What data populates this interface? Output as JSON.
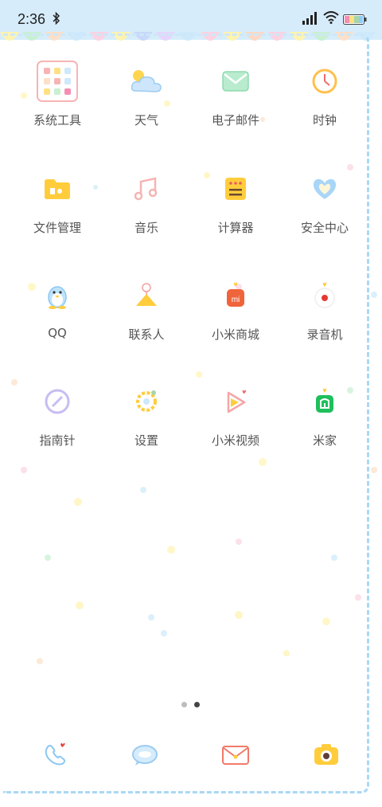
{
  "status": {
    "time": "2:36"
  },
  "apps": [
    {
      "name": "系统工具",
      "icon": "folder-tools-icon"
    },
    {
      "name": "天气",
      "icon": "weather-icon"
    },
    {
      "name": "电子邮件",
      "icon": "email-icon"
    },
    {
      "name": "时钟",
      "icon": "clock-icon"
    },
    {
      "name": "文件管理",
      "icon": "file-manager-icon"
    },
    {
      "name": "音乐",
      "icon": "music-icon"
    },
    {
      "name": "计算器",
      "icon": "calculator-icon"
    },
    {
      "name": "安全中心",
      "icon": "security-icon"
    },
    {
      "name": "QQ",
      "icon": "qq-icon"
    },
    {
      "name": "联系人",
      "icon": "contacts-icon"
    },
    {
      "name": "小米商城",
      "icon": "mi-store-icon"
    },
    {
      "name": "录音机",
      "icon": "recorder-icon"
    },
    {
      "name": "指南针",
      "icon": "compass-icon"
    },
    {
      "name": "设置",
      "icon": "settings-icon"
    },
    {
      "name": "小米视频",
      "icon": "mi-video-icon"
    },
    {
      "name": "米家",
      "icon": "mijia-icon"
    }
  ],
  "dock": [
    {
      "icon": "phone-icon"
    },
    {
      "icon": "messages-icon"
    },
    {
      "icon": "envelope-icon"
    },
    {
      "icon": "camera-icon"
    }
  ],
  "pager": {
    "pages": 2,
    "current": 2
  },
  "colors": {
    "statusbar": "#d6ecfb",
    "frame_dash": "#a9d8f5",
    "label": "#555555"
  }
}
